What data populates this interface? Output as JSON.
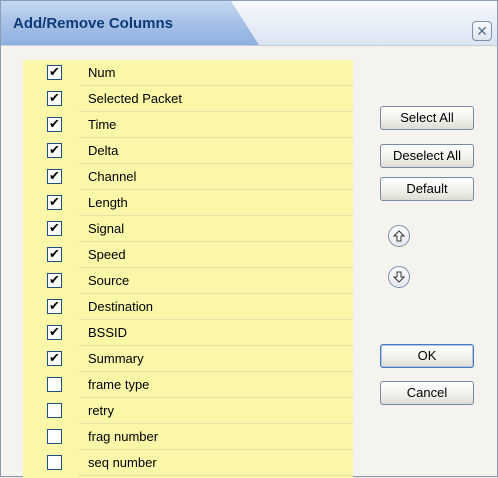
{
  "dialog": {
    "title": "Add/Remove Columns",
    "close_glyph": "✕"
  },
  "columns": [
    {
      "label": "Num",
      "checked": true
    },
    {
      "label": "Selected Packet",
      "checked": true
    },
    {
      "label": "Time",
      "checked": true
    },
    {
      "label": "Delta",
      "checked": true
    },
    {
      "label": "Channel",
      "checked": true
    },
    {
      "label": "Length",
      "checked": true
    },
    {
      "label": "Signal",
      "checked": true
    },
    {
      "label": "Speed",
      "checked": true
    },
    {
      "label": "Source",
      "checked": true
    },
    {
      "label": "Destination",
      "checked": true
    },
    {
      "label": "BSSID",
      "checked": true
    },
    {
      "label": "Summary",
      "checked": true
    },
    {
      "label": "frame type",
      "checked": false
    },
    {
      "label": "retry",
      "checked": false
    },
    {
      "label": "frag number",
      "checked": false
    },
    {
      "label": "seq number",
      "checked": false
    }
  ],
  "buttons": {
    "select_all": "Select All",
    "deselect_all": "Deselect All",
    "default": "Default",
    "ok": "OK",
    "cancel": "Cancel"
  },
  "icons": {
    "move_up": "arrow-up-icon",
    "move_down": "arrow-down-icon"
  },
  "colors": {
    "list_background": "#faf8a8",
    "title_text": "#0f3a7a"
  }
}
